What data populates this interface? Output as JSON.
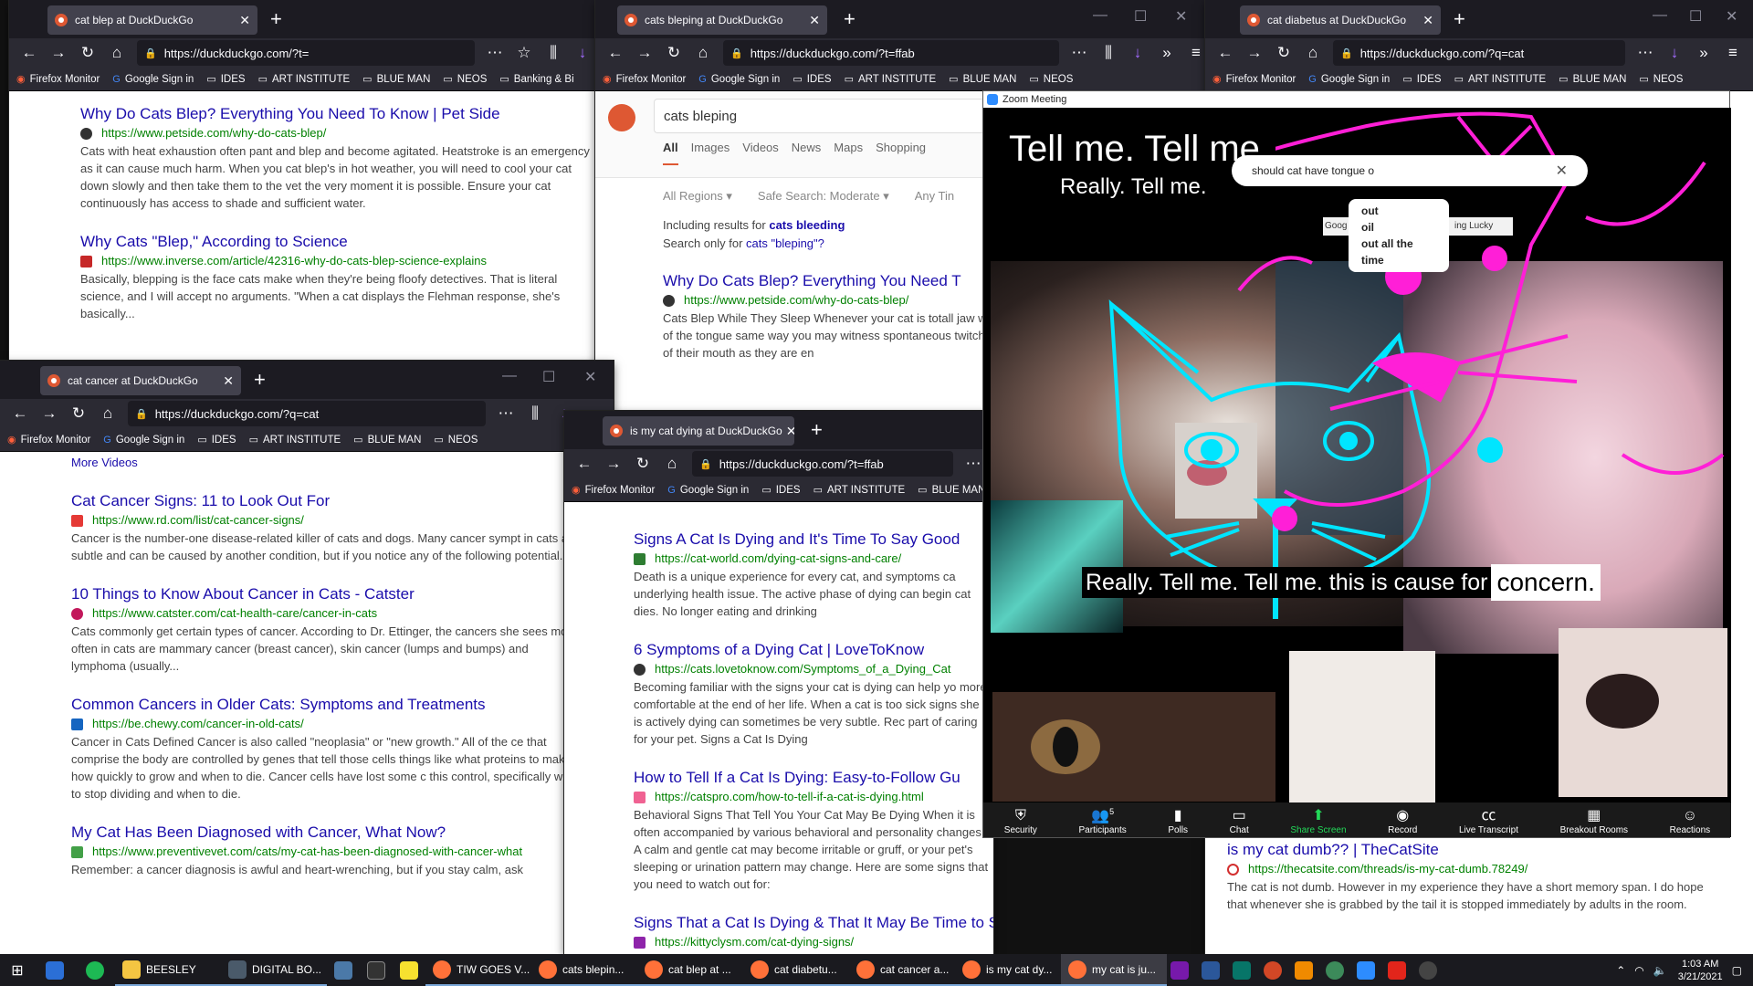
{
  "bookmarks": [
    "Firefox Monitor",
    "Google Sign in",
    "IDES",
    "ART INSTITUTE",
    "BLUE MAN",
    "NEOS",
    "Banking & Bi"
  ],
  "window_blep": {
    "tab_title": "cat blep at DuckDuckGo",
    "url": "https://duckduckgo.com/?t=",
    "results": [
      {
        "title": "Why Do Cats Blep? Everything You Need To Know | Pet Side",
        "url": "https://www.petside.com/why-do-cats-blep/",
        "snippet": "Cats with heat exhaustion often pant and blep and become agitated. Heatstroke is an emergency as it can cause much harm. When you cat blep's in hot weather, you will need to cool your cat down slowly and then take them to the vet the very moment it is possible. Ensure your cat continuously has access to shade and sufficient water."
      },
      {
        "title": "Why Cats \"Blep,\" According to Science",
        "url": "https://www.inverse.com/article/42316-why-do-cats-blep-science-explains",
        "snippet": "Basically, blepping is the face cats make when they're being floofy detectives. That is literal science, and I will accept no arguments. \"When a cat displays the Flehman response, she's basically..."
      }
    ]
  },
  "window_bleping": {
    "tab_title": "cats bleping at DuckDuckGo",
    "url": "https://duckduckgo.com/?t=ffab",
    "search_value": "cats bleping",
    "tabs": [
      "All",
      "Images",
      "Videos",
      "News",
      "Maps",
      "Shopping"
    ],
    "filters": [
      "All Regions",
      "Safe Search: Moderate",
      "Any Tin"
    ],
    "including_prefix": "Including results for ",
    "including_term": "cats bleeding",
    "only_prefix": "Search only for ",
    "only_term": "cats \"bleping\"?",
    "result": {
      "title": "Why Do Cats Blep? Everything You Need T",
      "url": "https://www.petside.com/why-do-cats-blep/",
      "snippet": "Cats Blep While They Sleep Whenever your cat is totall jaw which is just enough for the slight tip of the tongue same way you may witness spontaneous twitching as y blep as the tongue fall out of their mouth as they are en"
    }
  },
  "window_diabetus": {
    "tab_title": "cat diabetus at DuckDuckGo",
    "url": "https://duckduckgo.com/?q=cat",
    "result": {
      "title": "is my cat dumb?? | TheCatSite",
      "url": "https://thecatsite.com/threads/is-my-cat-dumb.78249/",
      "snippet": "The cat is not dumb. However in my experience they have a short memory span. I do hope that whenever she is grabbed by the tail it is stopped immediately by adults in the room."
    }
  },
  "window_cancer": {
    "tab_title": "cat cancer at DuckDuckGo",
    "url": "https://duckduckgo.com/?q=cat",
    "more_videos": "More Videos",
    "results": [
      {
        "title": "Cat Cancer Signs: 11 to Look Out For",
        "url": "https://www.rd.com/list/cat-cancer-signs/",
        "snippet": "Cancer is the number-one disease-related killer of cats and dogs. Many cancer sympt in cats are subtle and can be caused by another condition, but if you notice any of the following potential..."
      },
      {
        "title": "10 Things to Know About Cancer in Cats - Catster",
        "url": "https://www.catster.com/cat-health-care/cancer-in-cats",
        "snippet": "Cats commonly get certain types of cancer. According to Dr. Ettinger, the cancers she sees most often in cats are mammary cancer (breast cancer), skin cancer (lumps and bumps) and lymphoma (usually..."
      },
      {
        "title": "Common Cancers in Older Cats: Symptoms and Treatments",
        "url": "https://be.chewy.com/cancer-in-old-cats/",
        "snippet": "Cancer in Cats Defined Cancer is also called \"neoplasia\" or \"new growth.\" All of the ce that comprise the body are controlled by genes that tell those cells things like what proteins to make, how quickly to grow and when to die. Cancer cells have lost some c this control, specifically when to stop dividing and when to die."
      },
      {
        "title": "My Cat Has Been Diagnosed with Cancer, What Now?",
        "url": "https://www.preventivevet.com/cats/my-cat-has-been-diagnosed-with-cancer-what",
        "snippet": "Remember: a cancer diagnosis is awful and heart-wrenching, but if you stay calm, ask"
      }
    ]
  },
  "window_dying": {
    "tab_title": "is my cat dying at DuckDuckGo",
    "url": "https://duckduckgo.com/?t=ffab",
    "results": [
      {
        "title": "Signs A Cat Is Dying and It's Time To Say Good",
        "url": "https://cat-world.com/dying-cat-signs-and-care/",
        "snippet": "Death is a unique experience for every cat, and symptoms ca underlying health issue. The active phase of dying can begin cat dies. No longer eating and drinking"
      },
      {
        "title": "6 Symptoms of a Dying Cat | LoveToKnow",
        "url": "https://cats.lovetoknow.com/Symptoms_of_a_Dying_Cat",
        "snippet": "Becoming familiar with the signs your cat is dying can help yo more comfortable at the end of her life. When a cat is too sick signs she is actively dying can sometimes be very subtle. Rec part of caring for your pet. Signs a Cat Is Dying"
      },
      {
        "title": "How to Tell If a Cat Is Dying: Easy-to-Follow Gu",
        "url": "https://catspro.com/how-to-tell-if-a-cat-is-dying.html",
        "snippet": "Behavioral Signs That Tell You Your Cat May Be Dying When it is often accompanied by various behavioral and personality changes. A calm and gentle cat may become irritable or gruff, or your pet's sleeping or urination pattern may change. Here are some signs that you need to watch out for:"
      },
      {
        "title": "Signs That a Cat Is Dying & That It May Be Time to Say Goodbye",
        "url": "https://kittyclysm.com/cat-dying-signs/",
        "snippet": ""
      }
    ]
  },
  "zoom": {
    "title": "Zoom Meeting",
    "caption_top_1": "Tell me. Tell me.",
    "caption_top_2": "Really. Tell me.",
    "google_query": "should cat have tongue o",
    "suggestions": [
      "out",
      "oil",
      "out all the time"
    ],
    "google_btn": "Goog",
    "lucky_btn": "ing Lucky",
    "caption_bottom": "Really. Tell me. Tell me. this is cause for",
    "caption_bottom_end": "concern.",
    "participants_count": "5",
    "toolbar": [
      "Security",
      "Participants",
      "Polls",
      "Chat",
      "Share Screen",
      "Record",
      "Live Transcript",
      "Breakout Rooms",
      "Reactions"
    ]
  },
  "taskbar": {
    "apps": [
      "BEESLEY",
      "DIGITAL BO...",
      "TIW GOES V...",
      "cats blepin...",
      "cat blep at ...",
      "cat diabetu...",
      "cat cancer a...",
      "is my cat dy...",
      "my cat is ju..."
    ],
    "time": "1:03 AM",
    "date": "3/21/2021"
  },
  "colors": {
    "link": "#1a0dab",
    "url_green": "#008000",
    "firefox_dark": "#1c1b22",
    "cyan_drawing": "#00e5ff",
    "magenta_drawing": "#ff1fd7",
    "share_green": "#23d959"
  }
}
